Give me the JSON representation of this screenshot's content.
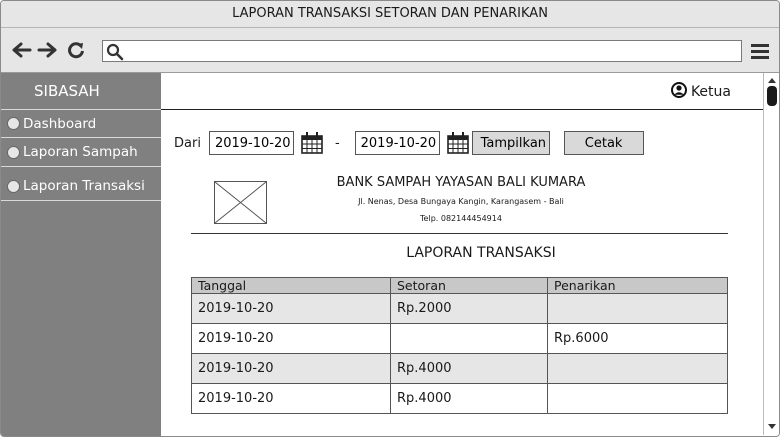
{
  "window": {
    "title": "LAPORAN TRANSAKSI SETORAN DAN PENARIKAN"
  },
  "browser": {
    "url": ""
  },
  "sidebar": {
    "title": "SIBASAH",
    "items": [
      {
        "label": "Dashboard"
      },
      {
        "label": "Laporan Sampah"
      },
      {
        "label": "Laporan Transaksi"
      }
    ]
  },
  "header": {
    "user_label": "Ketua"
  },
  "filter": {
    "from_label": "Dari",
    "from_date": "2019-10-20",
    "separator": "-",
    "to_date": "2019-10-20",
    "show_button": "Tampilkan",
    "print_button": "Cetak"
  },
  "report": {
    "org_name": "BANK SAMPAH YAYASAN BALI KUMARA",
    "address": "Jl. Nenas, Desa Bungaya Kangin, Karangasem - Bali",
    "phone": "Telp. 082144454914",
    "title": "LAPORAN TRANSAKSI"
  },
  "table": {
    "headers": [
      "Tanggal",
      "Setoran",
      "Penarikan"
    ],
    "rows": [
      [
        "2019-10-20",
        "Rp.2000",
        ""
      ],
      [
        "2019-10-20",
        "",
        "Rp.6000"
      ],
      [
        "2019-10-20",
        "Rp.4000",
        ""
      ],
      [
        "2019-10-20",
        "Rp.4000",
        ""
      ]
    ]
  }
}
